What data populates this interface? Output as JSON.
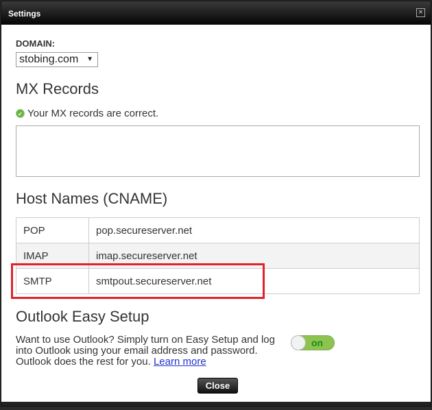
{
  "dialog": {
    "title": "Settings",
    "close_icon": "×"
  },
  "domain": {
    "label": "DOMAIN:",
    "selected": "stobing.com"
  },
  "mx": {
    "heading": "MX Records",
    "status": "Your MX records are correct."
  },
  "cname": {
    "heading": "Host Names (CNAME)",
    "rows": [
      {
        "type": "POP",
        "host": "pop.secureserver.net"
      },
      {
        "type": "IMAP",
        "host": "imap.secureserver.net"
      },
      {
        "type": "SMTP",
        "host": "smtpout.secureserver.net"
      }
    ]
  },
  "outlook": {
    "heading": "Outlook Easy Setup",
    "text": "Want to use Outlook? Simply turn on Easy Setup and log into Outlook using your email address and password. Outlook does the rest for you.",
    "link": "Learn more",
    "toggle": "on"
  },
  "footer": {
    "close_label": "Close"
  },
  "colors": {
    "highlight": "#e0202a",
    "toggle": "#8dc44f"
  }
}
